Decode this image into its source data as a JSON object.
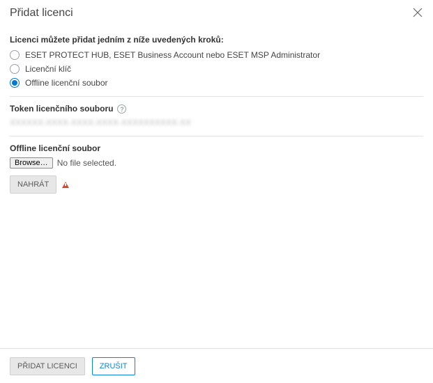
{
  "header": {
    "title": "Přidat licenci"
  },
  "intro": "Licenci můžete přidat jedním z níže uvedených kroků:",
  "options": {
    "opt0": "ESET PROTECT HUB, ESET Business Account nebo ESET MSP Administrator",
    "opt1": "Licenční klíč",
    "opt2": "Offline licenční soubor"
  },
  "token": {
    "label": "Token licenčního souboru",
    "blurred": "XXXXXX-XXXX-XXXX-XXXX-XXXXXXXXXX-XX"
  },
  "offline": {
    "label": "Offline licenční soubor",
    "browse": "Browse…",
    "no_file": "No file selected.",
    "upload": "NAHRÁT"
  },
  "footer": {
    "primary": "PŘIDAT LICENCI",
    "cancel": "ZRUŠIT"
  }
}
